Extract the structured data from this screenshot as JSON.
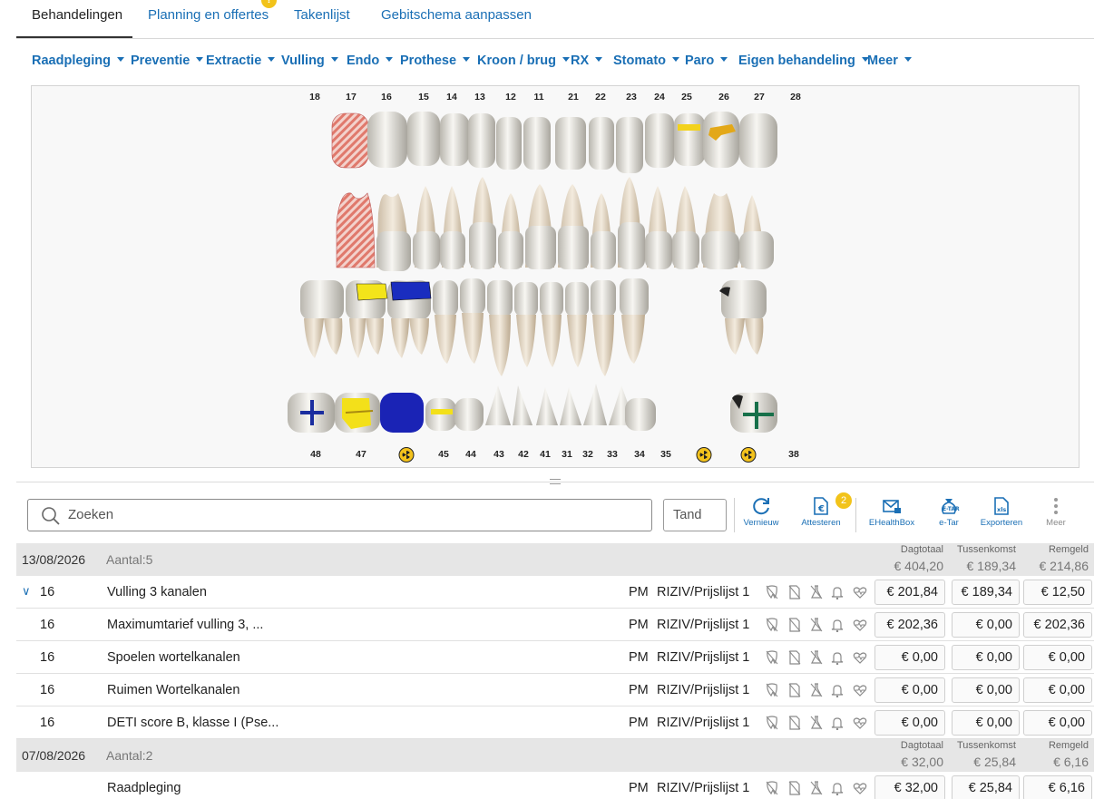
{
  "tabs": {
    "behandelingen": "Behandelingen",
    "planning": "Planning en offertes",
    "planning_badge": "!",
    "takenlijst": "Takenlijst",
    "gebitschema": "Gebitschema aanpassen"
  },
  "categories": [
    "Raadpleging",
    "Preventie",
    "Extractie",
    "Vulling",
    "Endo",
    "Prothese",
    "Kroon / brug",
    "RX",
    "Stomato",
    "Paro",
    "Eigen behandeling",
    "Meer"
  ],
  "chart": {
    "upper_numbers": [
      "18",
      "17",
      "16",
      "15",
      "14",
      "13",
      "12",
      "11",
      "21",
      "22",
      "23",
      "24",
      "25",
      "26",
      "27",
      "28"
    ],
    "lower_numbers": [
      "48",
      "47",
      "45",
      "44",
      "43",
      "42",
      "41",
      "31",
      "32",
      "33",
      "34",
      "35",
      "38"
    ]
  },
  "toolbar": {
    "search_placeholder": "Zoeken",
    "tand_placeholder": "Tand",
    "vernieuw": "Vernieuw",
    "attesteren": "Attesteren",
    "attesteren_badge": "2",
    "ehealthbox": "EHealthBox",
    "etar": "e-Tar",
    "exporteren": "Exporteren",
    "meer": "Meer"
  },
  "headers": {
    "dagtotaal": "Dagtotaal",
    "tussenkomst": "Tussenkomst",
    "remgeld": "Remgeld"
  },
  "groups": [
    {
      "date": "13/08/2026",
      "count": "Aantal:5",
      "dagtotaal": "€ 404,20",
      "tussenkomst": "€ 189,34",
      "remgeld": "€ 214,86"
    },
    {
      "date": "07/08/2026",
      "count": "Aantal:2",
      "dagtotaal": "€ 32,00",
      "tussenkomst": "€ 25,84",
      "remgeld": "€ 6,16"
    }
  ],
  "rows": [
    {
      "tooth": "16",
      "desc": "Vulling 3 kanalen",
      "by": "PM",
      "list": "RIZIV/Prijslijst 1",
      "amount": "€ 201,84",
      "tussenkomst": "€ 189,34",
      "remgeld": "€ 12,50"
    },
    {
      "tooth": "16",
      "desc": "Maximumtarief vulling 3, ...",
      "by": "PM",
      "list": "RIZIV/Prijslijst 1",
      "amount": "€ 202,36",
      "tussenkomst": "€ 0,00",
      "remgeld": "€ 202,36"
    },
    {
      "tooth": "16",
      "desc": "Spoelen wortelkanalen",
      "by": "PM",
      "list": "RIZIV/Prijslijst 1",
      "amount": "€ 0,00",
      "tussenkomst": "€ 0,00",
      "remgeld": "€ 0,00"
    },
    {
      "tooth": "16",
      "desc": "Ruimen Wortelkanalen",
      "by": "PM",
      "list": "RIZIV/Prijslijst 1",
      "amount": "€ 0,00",
      "tussenkomst": "€ 0,00",
      "remgeld": "€ 0,00"
    },
    {
      "tooth": "16",
      "desc": "DETI score B, klasse I (Pse...",
      "by": "PM",
      "list": "RIZIV/Prijslijst 1",
      "amount": "€ 0,00",
      "tussenkomst": "€ 0,00",
      "remgeld": "€ 0,00"
    },
    {
      "tooth": "",
      "desc": "Raadpleging",
      "by": "PM",
      "list": "RIZIV/Prijslijst 1",
      "amount": "€ 32,00",
      "tussenkomst": "€ 25,84",
      "remgeld": "€ 6,16"
    }
  ]
}
